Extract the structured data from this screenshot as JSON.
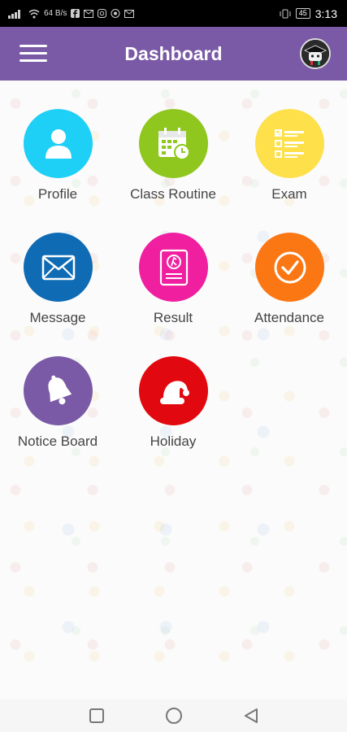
{
  "status_bar": {
    "time": "3:13",
    "battery": "45",
    "net_speed": "64 B/s",
    "icons": [
      "signal-icon",
      "wifi-icon",
      "facebook-icon",
      "gmail-icon",
      "instagram-icon",
      "game-icon",
      "gmail-icon",
      "vibrate-icon"
    ]
  },
  "app_bar": {
    "title": "Dashboard",
    "color": "#7a5aa6"
  },
  "tiles": [
    {
      "label": "Profile",
      "icon": "person-icon",
      "color": "#1ecff6"
    },
    {
      "label": "Class Routine",
      "icon": "calendar-icon",
      "color": "#8fc71e"
    },
    {
      "label": "Exam",
      "icon": "checklist-icon",
      "color": "#fde04a"
    },
    {
      "label": "Message",
      "icon": "envelope-icon",
      "color": "#0e6bb4"
    },
    {
      "label": "Result",
      "icon": "report-card-icon",
      "color": "#f01fa0"
    },
    {
      "label": "Attendance",
      "icon": "check-circle-icon",
      "color": "#fb7713"
    },
    {
      "label": "Notice Board",
      "icon": "bell-icon",
      "color": "#7a5aa6"
    },
    {
      "label": "Holiday",
      "icon": "santa-hat-icon",
      "color": "#e2080f"
    }
  ],
  "nav_bar": {
    "buttons": [
      "recent-apps-icon",
      "home-icon",
      "back-icon"
    ]
  }
}
